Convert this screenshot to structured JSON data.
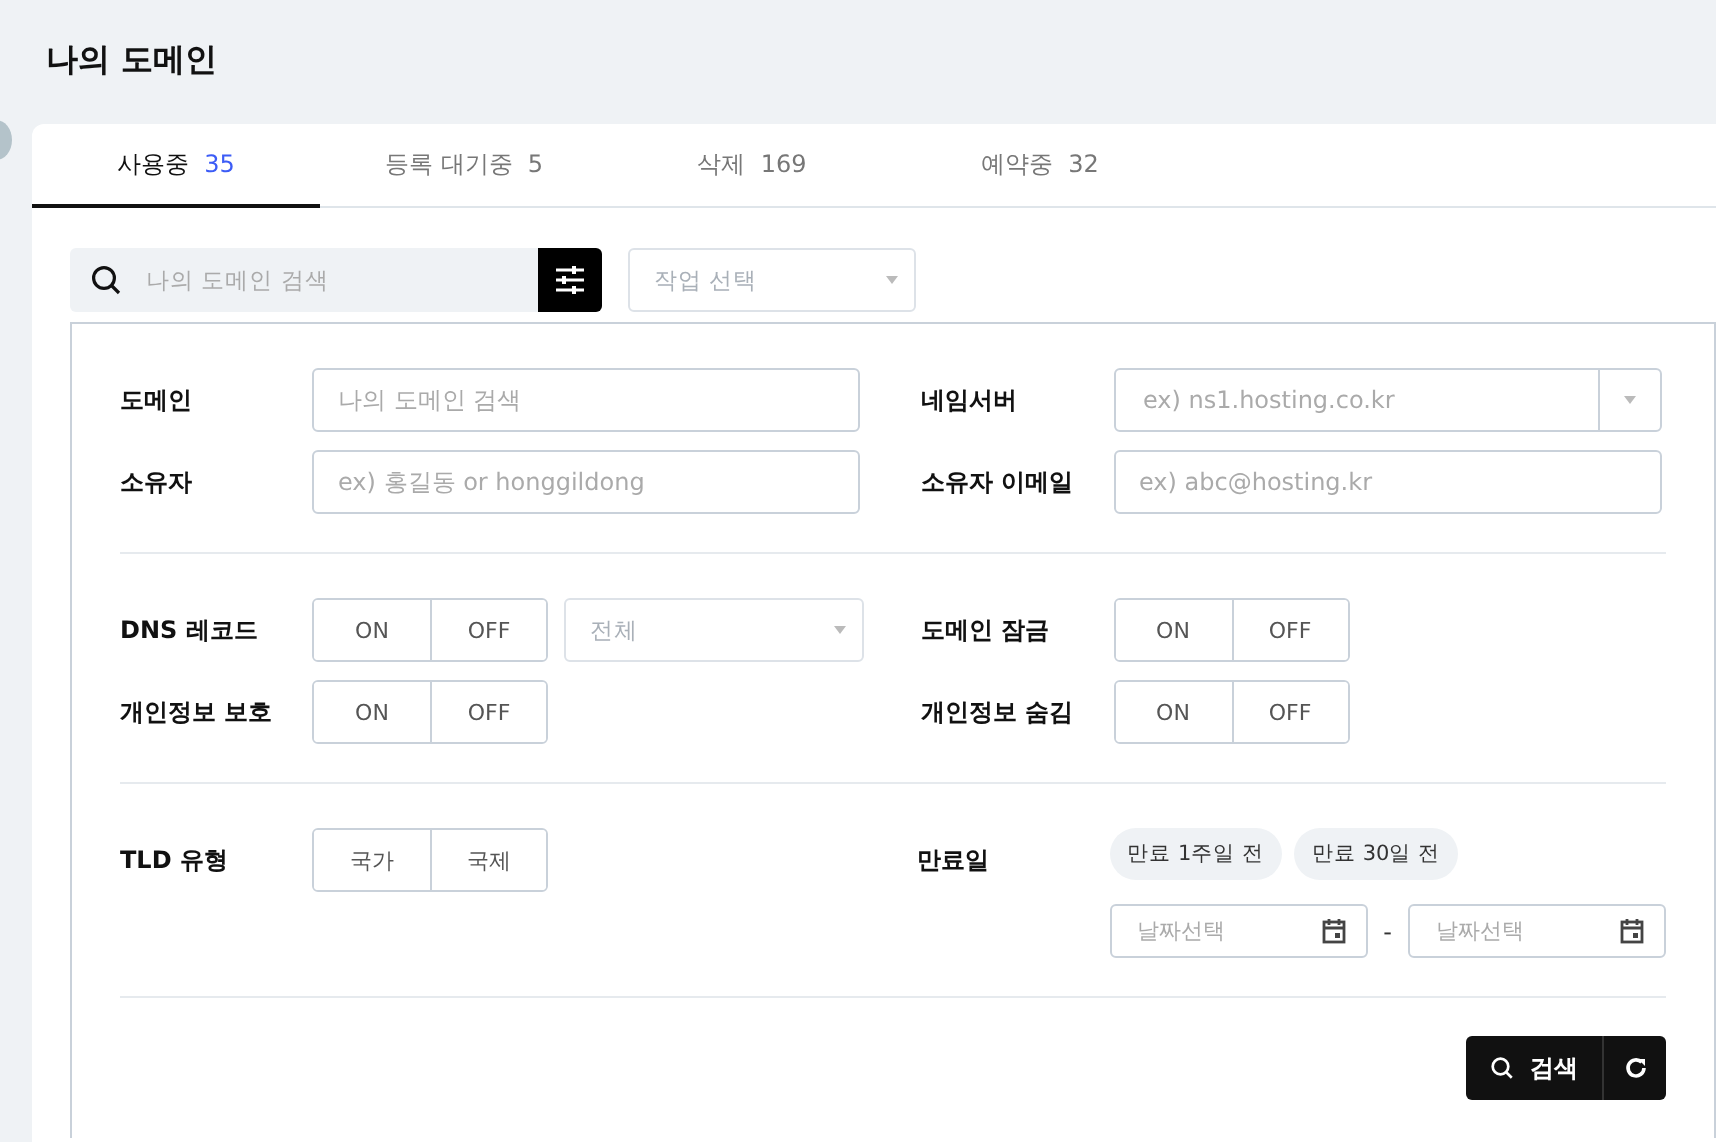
{
  "page_title": "나의 도메인",
  "tabs": [
    {
      "label": "사용중",
      "count": "35",
      "selected": true
    },
    {
      "label": "등록 대기중",
      "count": "5",
      "selected": false
    },
    {
      "label": "삭제",
      "count": "169",
      "selected": false
    },
    {
      "label": "예약중",
      "count": "32",
      "selected": false
    }
  ],
  "search": {
    "placeholder": "나의 도메인 검색"
  },
  "task_select": {
    "placeholder": "작업 선택",
    "disabled": true
  },
  "filter_sections": [
    {
      "rows": [
        {
          "kind": "input",
          "label": "도메인",
          "placeholder": "나의 도메인 검색"
        },
        {
          "kind": "select-input",
          "label": "네임서버",
          "placeholder": "ex) ns1.hosting.co.kr"
        },
        {
          "kind": "input",
          "label": "소유자",
          "placeholder": "ex) 홍길동 or honggildong"
        },
        {
          "kind": "input",
          "label": "소유자 이메일",
          "placeholder": "ex) abc@hosting.kr"
        }
      ]
    },
    {
      "rows": [
        {
          "kind": "toggle",
          "label": "DNS 레코드",
          "options": [
            "ON",
            "OFF"
          ],
          "select": {
            "placeholder": "전체",
            "disabled": true
          }
        },
        {
          "kind": "toggle",
          "label": "도메인 잠금",
          "options": [
            "ON",
            "OFF"
          ]
        },
        {
          "kind": "toggle",
          "label": "개인정보 보호",
          "options": [
            "ON",
            "OFF"
          ]
        },
        {
          "kind": "toggle",
          "label": "개인정보 숨김",
          "options": [
            "ON",
            "OFF"
          ]
        }
      ]
    },
    {
      "rows": [
        {
          "kind": "toggle",
          "label": "TLD 유형",
          "options": [
            "국가",
            "국제"
          ]
        },
        {
          "kind": "dates",
          "label": "만료일",
          "chips": [
            "만료 1주일 전",
            "만료 30일 전"
          ],
          "from_placeholder": "날짜선택",
          "separator": "-",
          "to_placeholder": "날짜선택"
        }
      ]
    }
  ],
  "search_button": "검색"
}
